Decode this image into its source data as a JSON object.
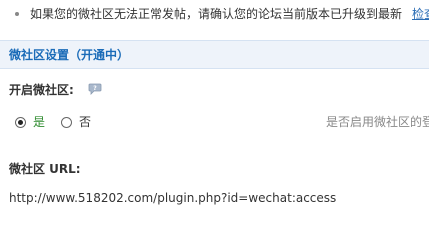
{
  "notice": {
    "text": "如果您的微社区无法正常发帖，请确认您的论坛当前版本已升级到最新",
    "link": "检查"
  },
  "section": {
    "title": "微社区设置（开通中）"
  },
  "enable": {
    "label": "开启微社区:",
    "options": [
      {
        "label": "是",
        "checked": true
      },
      {
        "label": "否",
        "checked": false
      }
    ],
    "hint": "是否启用微社区的登"
  },
  "url": {
    "label": "微社区 URL:",
    "value": "http://www.518202.com/plugin.php?id=wechat:access"
  },
  "colors": {
    "section_bg": "#eef3fa",
    "section_title": "#1a6bb8",
    "yes_label": "#2e8b2e",
    "hint": "#888888"
  }
}
